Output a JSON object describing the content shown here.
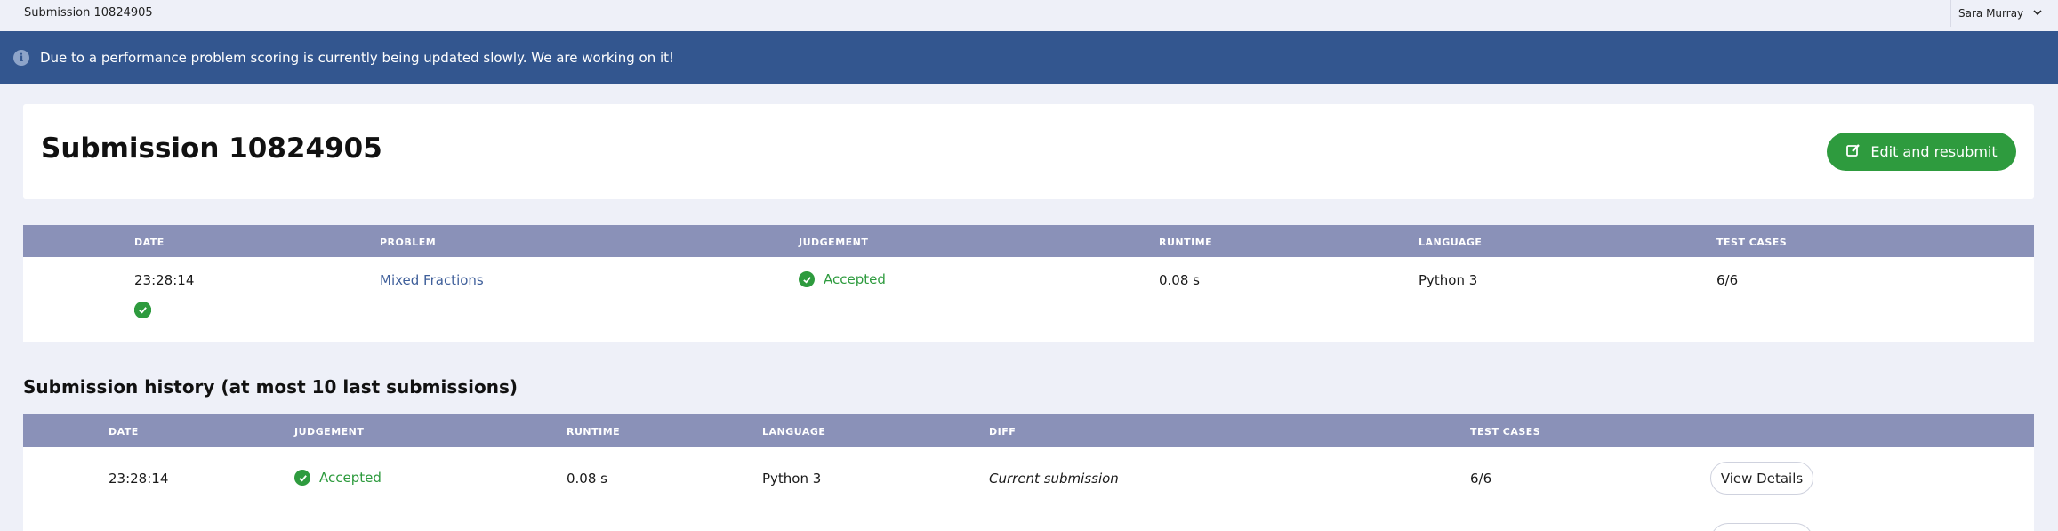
{
  "topbar": {
    "title": "Submission 10824905",
    "user": "Sara Murray"
  },
  "banner": {
    "message": "Due to a performance problem scoring is currently being updated slowly. We are working on it!"
  },
  "header": {
    "title": "Submission 10824905",
    "resubmit_label": "Edit and resubmit"
  },
  "submission_table": {
    "headers": {
      "date": "DATE",
      "problem": "PROBLEM",
      "judgement": "JUDGEMENT",
      "runtime": "RUNTIME",
      "language": "LANGUAGE",
      "test_cases": "TEST CASES"
    },
    "row": {
      "date": "23:28:14",
      "problem": "Mixed Fractions",
      "judgement": "Accepted",
      "runtime": "0.08 s",
      "language": "Python 3",
      "test_cases": "6/6",
      "test_case_results": [
        "passed",
        "passed",
        "passed",
        "passed",
        "passed",
        "passed"
      ]
    }
  },
  "history": {
    "title": "Submission history (at most 10 last submissions)",
    "headers": {
      "date": "DATE",
      "judgement": "JUDGEMENT",
      "runtime": "RUNTIME",
      "language": "LANGUAGE",
      "diff": "DIFF",
      "test_cases": "TEST CASES"
    },
    "rows": [
      {
        "date": "23:28:14",
        "judgement": "Accepted",
        "runtime": "0.08 s",
        "language": "Python 3",
        "diff": "Current submission",
        "test_cases": "6/6",
        "action": "View Details"
      }
    ]
  },
  "colors": {
    "accent_green": "#2e9b3e",
    "banner_blue": "#33568f",
    "table_header": "#8a91b8",
    "link_blue": "#3f5f9a"
  }
}
